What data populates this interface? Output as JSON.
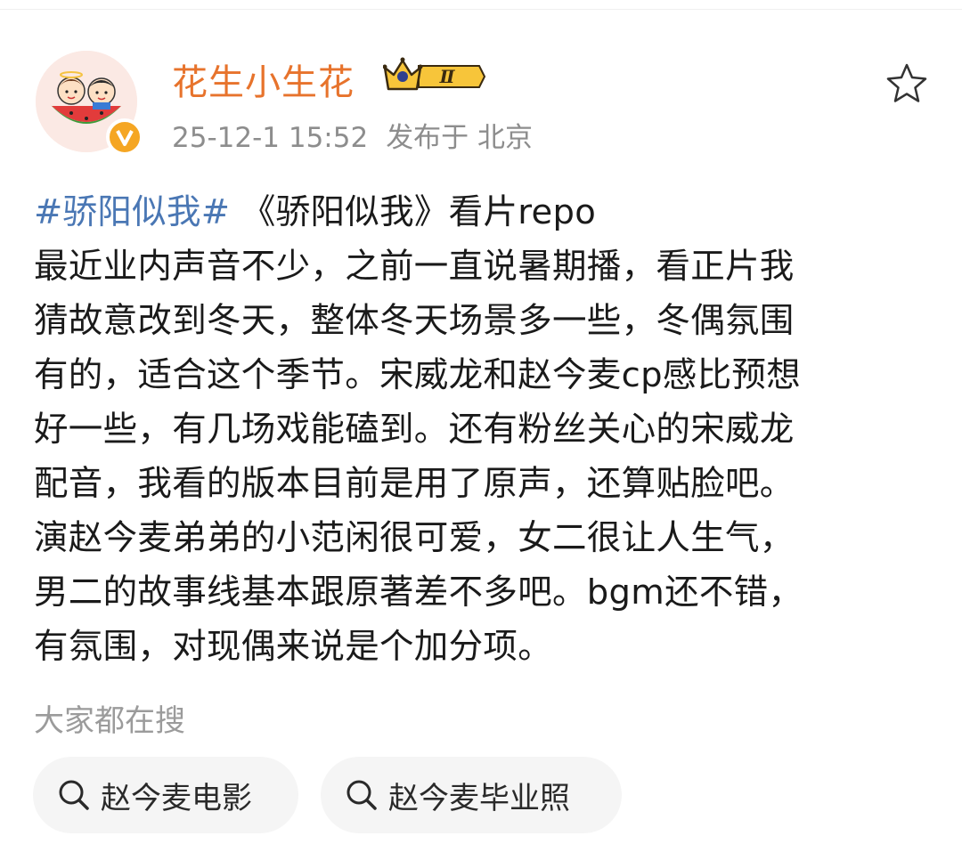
{
  "post": {
    "author": "花生小生花",
    "level_badge": "Ⅱ",
    "timestamp": "25-12-1 15:52",
    "location": "发布于 北京",
    "avatar_icon": "cartoon-couple-avatar-icon",
    "verified_icon": "verified-v-icon",
    "favorite_icon": "star-outline-icon",
    "content": {
      "hashtag": "#骄阳似我#",
      "line1_rest": " 《骄阳似我》看片repo",
      "lines": [
        "最近业内声音不少，之前一直说暑期播，看正片我",
        "猜故意改到冬天，整体冬天场景多一些，冬偶氛围",
        "有的，适合这个季节。宋威龙和赵今麦cp感比预想",
        "好一些，有几场戏能磕到。还有粉丝关心的宋威龙",
        "配音，我看的版本目前是用了原声，还算贴脸吧。",
        "演赵今麦弟弟的小范闲很可爱，女二很让人生气，",
        "男二的故事线基本跟原著差不多吧。bgm还不错，",
        "有氛围，对现偶来说是个加分项。"
      ]
    }
  },
  "related_search": {
    "label": "大家都在搜",
    "chips": [
      "赵今麦电影",
      "赵今麦毕业照"
    ]
  },
  "colors": {
    "username": "#e7732c",
    "hashtag": "#4a77b4",
    "meta": "#8d8d8d",
    "verified": "#f5a623",
    "chip_bg": "#f5f5f5"
  }
}
